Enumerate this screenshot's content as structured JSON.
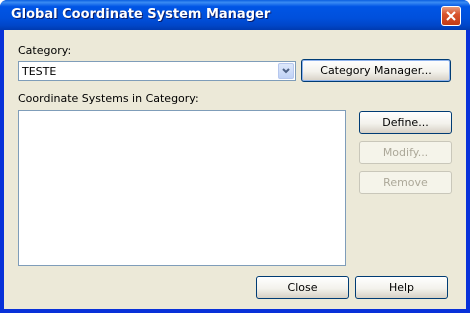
{
  "window": {
    "title": "Global Coordinate System Manager"
  },
  "category": {
    "label": "Category:",
    "selected_value": "TESTE"
  },
  "coordinate_systems": {
    "label": "Coordinate Systems in Category:",
    "items": []
  },
  "buttons": {
    "category_manager": "Category Manager...",
    "define": "Define...",
    "modify": "Modify...",
    "remove": "Remove",
    "close": "Close",
    "help": "Help"
  },
  "icons": {
    "close": "close-icon",
    "dropdown": "chevron-down-icon"
  },
  "colors": {
    "titlebar": "#0055e5",
    "dialog_bg": "#ece9d8",
    "close_button": "#d9542d"
  }
}
